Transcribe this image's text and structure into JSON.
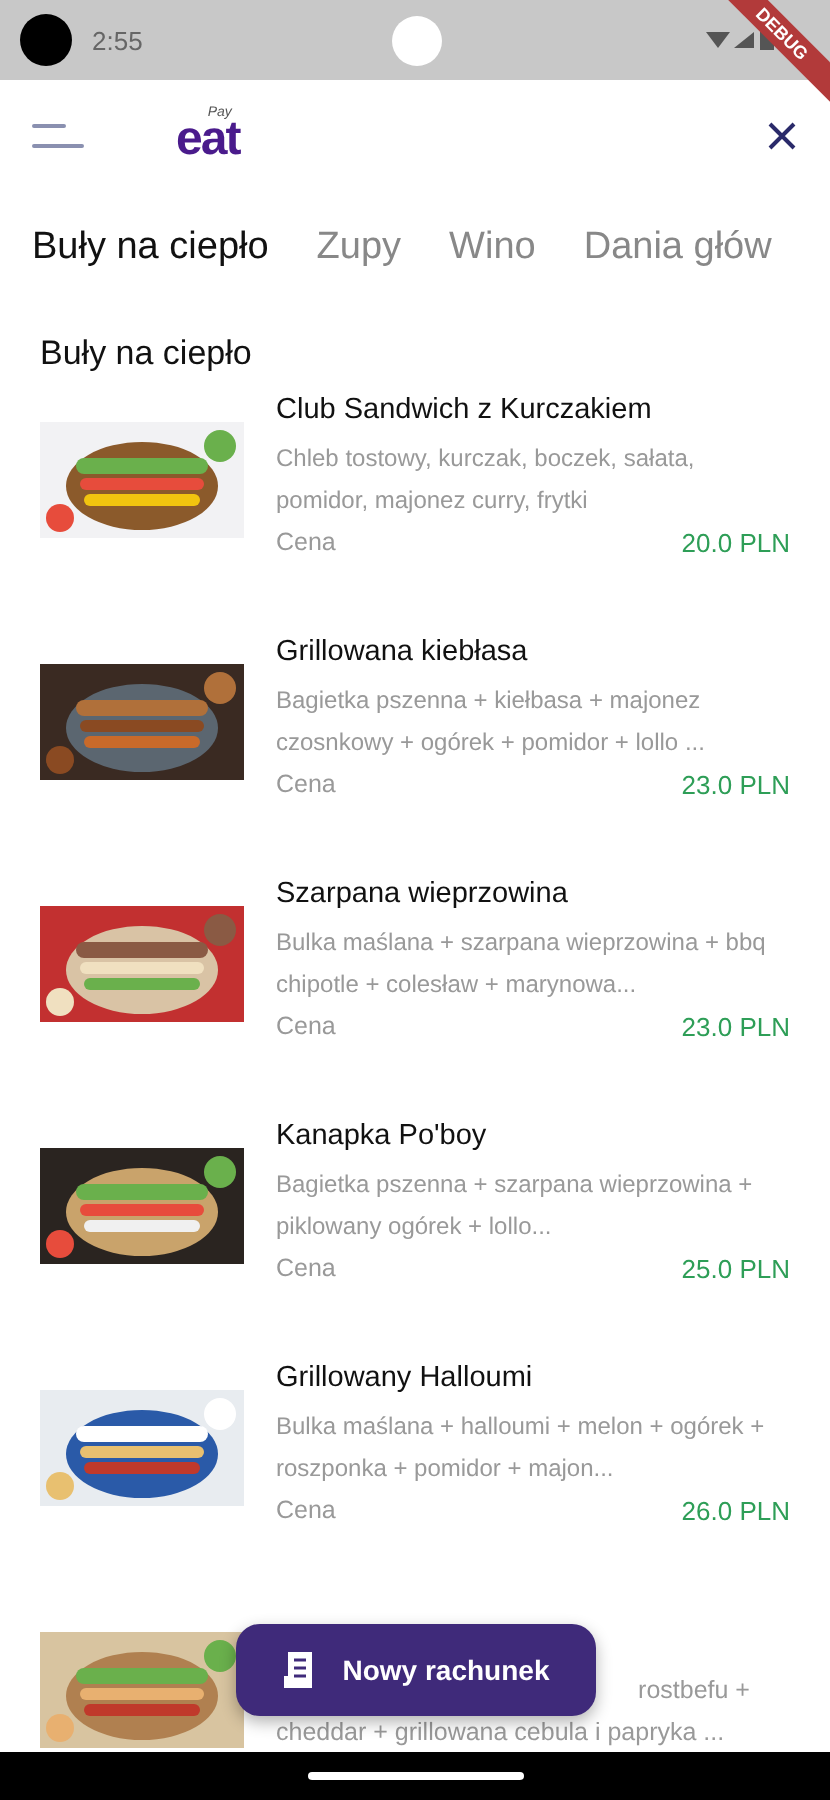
{
  "status_bar": {
    "time": "2:55"
  },
  "debug_banner": "DEBUG",
  "app_bar": {
    "logo_small": "Pay",
    "logo": "eat"
  },
  "tabs": [
    {
      "label": "Buły na ciepło",
      "selected": true
    },
    {
      "label": "Zupy",
      "selected": false
    },
    {
      "label": "Wino",
      "selected": false
    },
    {
      "label": "Dania głów",
      "selected": false
    }
  ],
  "section_title": "Buły na ciepło",
  "items": [
    {
      "kind": "full",
      "name": "Club Sandwich z Kurczakiem",
      "description": "Chleb tostowy, kurczak, boczek, sałata, pomidor, majonez curry, frytki",
      "price_label": "Cena",
      "price": "20.0 PLN"
    },
    {
      "kind": "full",
      "name": "Grillowana kiebłasa",
      "description": "Bagietka pszenna + kiełbasa + majonez czosnkowy + ogórek + pomidor + lollo ...",
      "price_label": "Cena",
      "price": "23.0 PLN"
    },
    {
      "kind": "full",
      "name": "Szarpana wieprzowina",
      "description": "Bulka maślana + szarpana wieprzowina + bbq chipotle + colesław + marynowa...",
      "price_label": "Cena",
      "price": "23.0 PLN"
    },
    {
      "kind": "full",
      "name": "Kanapka Po'boy",
      "description": "Bagietka pszenna + szarpana wieprzowina + piklowany ogórek + lollo...",
      "price_label": "Cena",
      "price": "25.0 PLN"
    },
    {
      "kind": "full",
      "name": "Grillowany Halloumi",
      "description": "Bulka maślana + halloumi + melon + ogórek + roszponka + pomidor + majon...",
      "price_label": "Cena",
      "price": "26.0 PLN"
    },
    {
      "kind": "partial",
      "lines": [
        "rostbefu +",
        "cheddar + grillowana cebula i papryka ..."
      ]
    }
  ],
  "fab": {
    "label": "Nowy rachunek"
  }
}
